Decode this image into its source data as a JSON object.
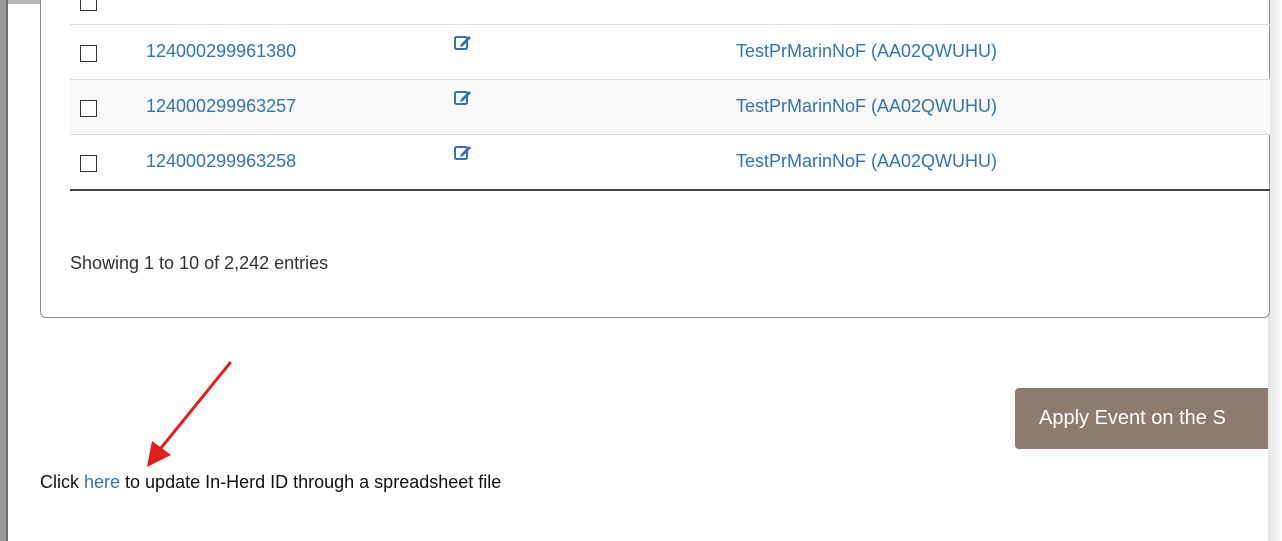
{
  "table": {
    "rows": [
      {
        "id": "124000299961380",
        "name": "TestPrMarinNoF (AA02QWUHU)"
      },
      {
        "id": "124000299963257",
        "name": "TestPrMarinNoF (AA02QWUHU)"
      },
      {
        "id": "124000299963258",
        "name": "TestPrMarinNoF (AA02QWUHU)"
      }
    ],
    "edit_icon": "edit-icon"
  },
  "footer": {
    "showing_text": "Showing 1 to 10 of 2,242 entries"
  },
  "actions": {
    "apply_label": "Apply Event on the S"
  },
  "spreadsheet_note": {
    "prefix": "Click ",
    "link": "here",
    "suffix": " to update In-Herd ID through a spreadsheet file"
  },
  "colors": {
    "link": "#2f74b8",
    "button": "#8c7b70",
    "annotation_arrow": "#e0201b"
  }
}
